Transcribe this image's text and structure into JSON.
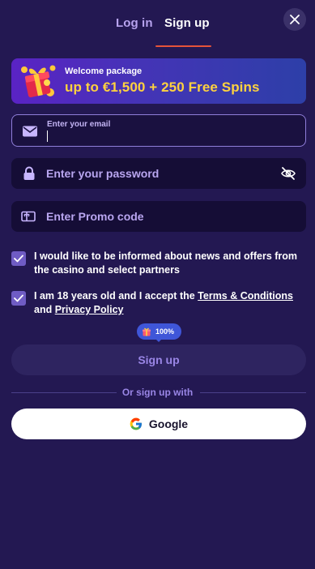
{
  "tabs": {
    "login": "Log in",
    "signup": "Sign up",
    "active": "signup"
  },
  "banner": {
    "small": "Welcome package",
    "big": "up to €1,500 + 250 Free Spins"
  },
  "fields": {
    "email": {
      "label": "Enter your email",
      "value": ""
    },
    "password": {
      "placeholder": "Enter your password"
    },
    "promo": {
      "placeholder": "Enter Promo code"
    }
  },
  "consents": {
    "news": {
      "text": "I would like to be informed about news and offers from the casino and select partners",
      "checked": true
    },
    "age": {
      "prefix": "I am 18 years old and I accept the ",
      "terms": "Terms & Conditions",
      "and": " and ",
      "privacy": "Privacy Policy",
      "checked": true
    }
  },
  "badge": {
    "text": "100%",
    "icon": "gift-icon"
  },
  "signup_button": "Sign up",
  "divider": "Or sign up with",
  "google_button": "Google",
  "colors": {
    "background": "#231852",
    "accent": "#e5533a",
    "gold": "#ffd23f",
    "badge": "#3f56d8"
  }
}
